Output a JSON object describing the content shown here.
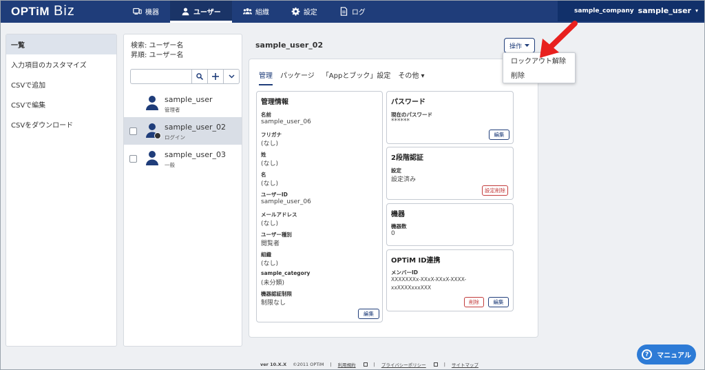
{
  "header": {
    "logo_main": "OPTiM",
    "logo_sub": "Biz",
    "nav": [
      {
        "label": "機器",
        "icon": "device-icon"
      },
      {
        "label": "ユーザー",
        "icon": "user-icon"
      },
      {
        "label": "組織",
        "icon": "group-icon"
      },
      {
        "label": "設定",
        "icon": "gear-icon"
      },
      {
        "label": "ログ",
        "icon": "document-icon"
      }
    ],
    "company": "sample_company",
    "user": "sample_user",
    "caret": "▾"
  },
  "leftmenu": {
    "items": [
      "一覧",
      "入力項目のカスタマイズ",
      "CSVで追加",
      "CSVで編集",
      "CSVをダウンロード"
    ]
  },
  "userpanel": {
    "search_line": "検索: ユーザー名",
    "sort_line": "昇順: ユーザー名",
    "search_value": "",
    "users": [
      {
        "name": "sample_user",
        "role": "管理者"
      },
      {
        "name": "sample_user_02",
        "role": "ログイン"
      },
      {
        "name": "sample_user_03",
        "role": "一般"
      }
    ]
  },
  "detail": {
    "title": "sample_user_02",
    "op_button": "操作",
    "dropdown": [
      "ロックアウト解除",
      "削除"
    ],
    "tabs": [
      "管理",
      "パッケージ",
      "「Appとブック」設定",
      "その他 ▾"
    ],
    "mgmt": {
      "heading": "管理情報",
      "fields": [
        {
          "label": "名前",
          "value": "sample_user_06"
        },
        {
          "label": "フリガナ",
          "value": "(なし)"
        },
        {
          "label": "姓",
          "value": "(なし)"
        },
        {
          "label": "名",
          "value": "(なし)"
        },
        {
          "label": "ユーザーID",
          "value": "sample_user_06"
        },
        {
          "label": "メールアドレス",
          "value": "(なし)"
        },
        {
          "label": "ユーザー種別",
          "value": "閲覧者"
        },
        {
          "label": "組織",
          "value": "(なし)"
        },
        {
          "label": "sample_category",
          "value": "(未分類)"
        },
        {
          "label": "機器認証制限",
          "value": "制限なし"
        }
      ],
      "edit": "編集"
    },
    "password": {
      "heading": "パスワード",
      "label": "現在のパスワード",
      "value": "******",
      "edit": "編集"
    },
    "twofa": {
      "heading": "2段階認証",
      "label": "設定",
      "value": "設定済み",
      "button": "設定削除"
    },
    "device": {
      "heading": "機器",
      "label": "機器数",
      "value": "0"
    },
    "optimid": {
      "heading": "OPTiM ID連携",
      "label": "メンバーID",
      "value1": "XXXXXXXx-XXxX-XXxX-XXXX-",
      "value2": "xxXXXXxxxXXX",
      "delete": "削除",
      "edit": "編集"
    }
  },
  "footer": {
    "version": "ver 10.X.X",
    "copyright": "©2011 OPTiM",
    "links": [
      "利用規約",
      "プライバシーポリシー",
      "サイトマップ"
    ]
  },
  "manual": "マニュアル",
  "colors": {
    "header": "#1f3d7a",
    "accent": "#2d7bd6",
    "arrow": "#e8201e",
    "danger": "#c23a3a"
  }
}
